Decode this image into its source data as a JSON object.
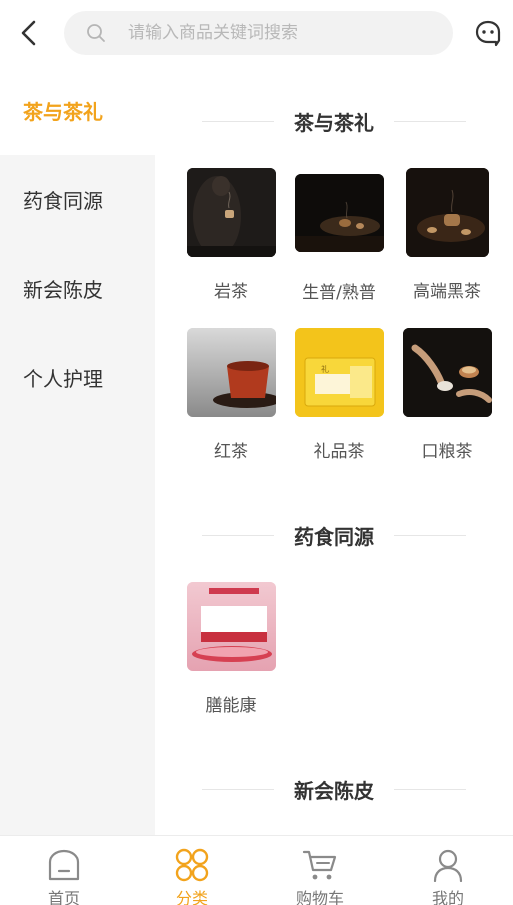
{
  "header": {
    "search_placeholder": "请输入商品关键词搜索",
    "back_icon": "chevron-left-icon",
    "service_icon": "customer-service-icon"
  },
  "sidebar": {
    "items": [
      {
        "label": "茶与茶礼",
        "active": true
      },
      {
        "label": "药食同源",
        "active": false
      },
      {
        "label": "新会陈皮",
        "active": false
      },
      {
        "label": "个人护理",
        "active": false
      }
    ]
  },
  "sections": [
    {
      "title": "茶与茶礼",
      "products": [
        {
          "name": "岩茶"
        },
        {
          "name": "生普/熟普"
        },
        {
          "name": "高端黑茶"
        },
        {
          "name": "红茶"
        },
        {
          "name": "礼品茶"
        },
        {
          "name": "口粮茶"
        }
      ]
    },
    {
      "title": "药食同源",
      "products": [
        {
          "name": "膳能康"
        }
      ]
    },
    {
      "title": "新会陈皮",
      "products": []
    }
  ],
  "tabbar": {
    "tabs": [
      {
        "label": "首页",
        "icon": "home-icon",
        "active": false
      },
      {
        "label": "分类",
        "icon": "category-icon",
        "active": true
      },
      {
        "label": "购物车",
        "icon": "cart-icon",
        "active": false
      },
      {
        "label": "我的",
        "icon": "user-icon",
        "active": false
      }
    ]
  },
  "colors": {
    "accent": "#f2a31c",
    "sidebar_bg": "#f5f5f5",
    "text": "#333333",
    "muted": "#999999"
  }
}
